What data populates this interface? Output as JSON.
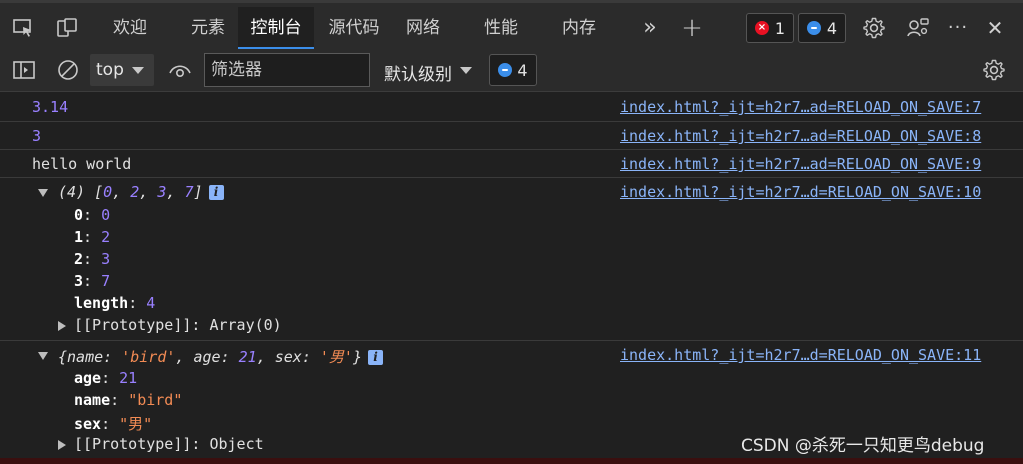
{
  "tabs": [
    {
      "label": "欢迎",
      "active": false
    },
    {
      "label": "元素",
      "active": false
    },
    {
      "label": "控制台",
      "active": true
    },
    {
      "label": "源代码",
      "active": false
    },
    {
      "label": "网络",
      "active": false
    },
    {
      "label": "性能",
      "active": false
    },
    {
      "label": "内存",
      "active": false
    }
  ],
  "tabbar": {
    "more_tabs_glyph": "»",
    "add_tab_glyph": "+",
    "error_count": "1",
    "message_count": "4",
    "error_badge_glyph": "×",
    "more_options_glyph": "···",
    "close_glyph": "✕"
  },
  "toolbar": {
    "context": "top",
    "filter_placeholder": "筛选器",
    "level_label": "默认级别",
    "issue_count": "4"
  },
  "console": {
    "messages": [
      {
        "text": "3.14",
        "source": "index.html?_ijt=h2r7…ad=RELOAD_ON_SAVE:7"
      },
      {
        "text": "3",
        "source": "index.html?_ijt=h2r7…ad=RELOAD_ON_SAVE:8"
      },
      {
        "text": "hello world",
        "source": "index.html?_ijt=h2r7…ad=RELOAD_ON_SAVE:9"
      }
    ],
    "array_log": {
      "summary_prefix": "(4) [",
      "summary_values": [
        "0",
        "2",
        "3",
        "7"
      ],
      "summary_suffix": "]",
      "source": "index.html?_ijt=h2r7…d=RELOAD_ON_SAVE:10",
      "props": [
        {
          "key": "0",
          "value": "0"
        },
        {
          "key": "1",
          "value": "2"
        },
        {
          "key": "2",
          "value": "3"
        },
        {
          "key": "3",
          "value": "7"
        },
        {
          "key": "length",
          "value": "4"
        }
      ],
      "prototype_key": "[[Prototype]]",
      "prototype_value": "Array(0)"
    },
    "object_log": {
      "source": "index.html?_ijt=h2r7…d=RELOAD_ON_SAVE:11",
      "summary": {
        "name_key": "name",
        "name_value": "'bird'",
        "age_key": "age",
        "age_value": "21",
        "sex_key": "sex",
        "sex_value": "'男'"
      },
      "props": [
        {
          "key": "age",
          "value": "21",
          "type": "num"
        },
        {
          "key": "name",
          "value": "\"bird\"",
          "type": "str"
        },
        {
          "key": "sex",
          "value": "\"男\"",
          "type": "str"
        }
      ],
      "prototype_key": "[[Prototype]]",
      "prototype_value": "Object"
    },
    "info_glyph": "i"
  },
  "watermark": "CSDN @杀死一只知更鸟debug",
  "colors": {
    "number": "#9980ff",
    "string": "#f28b54",
    "link": "#8ab4f8",
    "accent": "#3b8eea",
    "error": "#e81123"
  }
}
